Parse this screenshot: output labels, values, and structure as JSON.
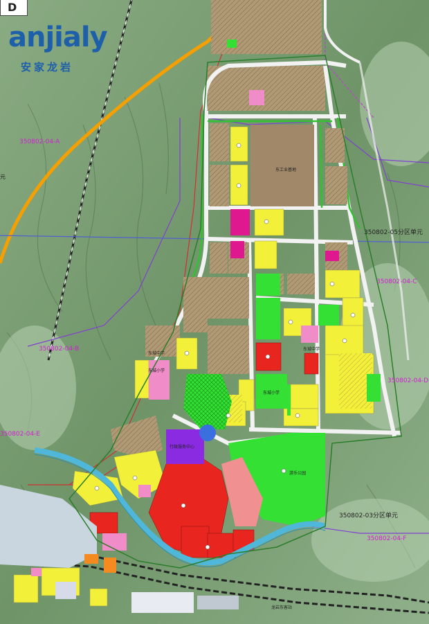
{
  "logo": {
    "brand": "anjialy",
    "subtitle": "安家龙岩"
  },
  "corner_label": "D",
  "planning_units": {
    "u_04_a": "350802-04-A",
    "u_04_b": "350802-04-B",
    "u_04_c": "350802-04-C",
    "u_04_d": "350802-04-D",
    "u_04_e": "350802-04-E",
    "u_04_f": "350802-04-F"
  },
  "zone_units": {
    "z05": "350802-05分区单元",
    "z03": "350802-03分区单元"
  },
  "edge_text": {
    "left_edge": "元"
  },
  "facilities": {
    "logistics": "东工业基地",
    "school_1": "东城中学",
    "school_2": "东城小学",
    "school_3": "东城中学",
    "school_4": "东城小学",
    "park": "游乐公园",
    "center": "行政服务中心",
    "station": "龙岩东客站"
  },
  "colors": {
    "terrain": "#7fa07a",
    "residential": "#f3f03a",
    "commercial": "#e8251f",
    "green": "#33e033",
    "industrial": "#a08868",
    "road": "#f2f2f2",
    "river": "#4fb7d9",
    "boundary_magenta": "#c040d0",
    "boundary_red": "#d03030",
    "highway": "#f5a000",
    "public": "#f08cc8",
    "admin": "#8a2be2",
    "unit_text": "#d020d0",
    "brand": "#1d5fa8"
  }
}
